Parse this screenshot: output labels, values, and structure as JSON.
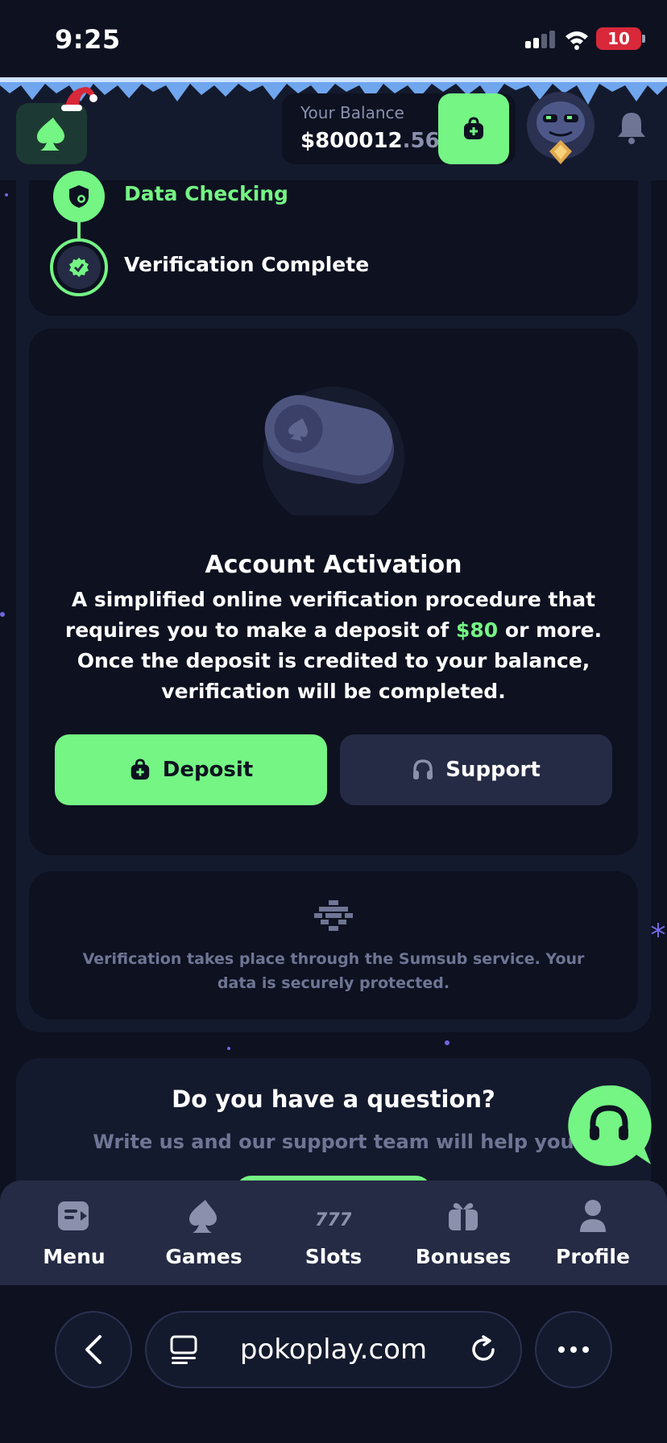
{
  "status_bar": {
    "time": "9:25",
    "battery": "10"
  },
  "header": {
    "balance_label": "Your Balance",
    "balance_main": "$800012",
    "balance_decimals": ".56"
  },
  "verification_steps": [
    {
      "label": "Data Checking",
      "state": "done"
    },
    {
      "label": "Verification Complete",
      "state": "current"
    }
  ],
  "activation": {
    "title": "Account Activation",
    "text_before": "A simplified online verification procedure that requires you to make a deposit of ",
    "amount": "$80",
    "text_after": " or more. Once the deposit is credited to your balance, verification will be completed.",
    "deposit_label": "Deposit",
    "support_label": "Support"
  },
  "sumsub_note": "Verification takes place through the Sumsub service. Your data is securely protected.",
  "question": {
    "title": "Do you have a question?",
    "subtitle": "Write us and our support team will help you"
  },
  "bottom_nav": [
    {
      "label": "Menu",
      "icon": "menu-icon"
    },
    {
      "label": "Games",
      "icon": "spade-icon"
    },
    {
      "label": "Slots",
      "icon": "slots-777-icon"
    },
    {
      "label": "Bonuses",
      "icon": "gift-icon"
    },
    {
      "label": "Profile",
      "icon": "user-icon"
    }
  ],
  "browser": {
    "url": "pokoplay.com"
  },
  "colors": {
    "accent": "#74f584",
    "background": "#0d1120",
    "panel": "#141a2d",
    "button_dark": "#252b44",
    "muted_text": "#6f7594"
  }
}
